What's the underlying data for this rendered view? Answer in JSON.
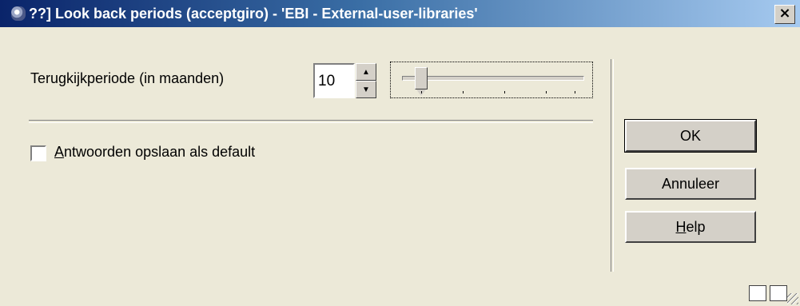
{
  "window": {
    "title": "??] Look back periods (acceptgiro) - 'EBI - External-user-libraries'",
    "close_label": "×"
  },
  "period": {
    "label": "Terugkijkperiode (in maanden)",
    "value": "10",
    "slider_level": 0.1
  },
  "checkbox": {
    "label_first": "A",
    "label_rest": "ntwoorden opslaan als default",
    "checked": false
  },
  "buttons": {
    "ok": "OK",
    "cancel": "Annuleer",
    "help_first": "H",
    "help_rest": "elp"
  },
  "icons": {
    "app": "app-icon",
    "spin_up": "spin-up-icon",
    "spin_down": "spin-down-icon",
    "status_1": "keyboard-icon",
    "status_2": "resize-icon"
  }
}
